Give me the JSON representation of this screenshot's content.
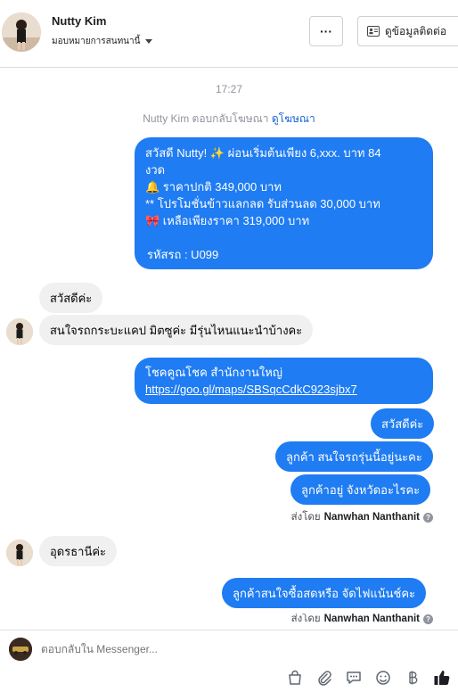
{
  "header": {
    "contact_name": "Nutty Kim",
    "assign_label": "มอบหมายการสนทนานี้",
    "more_label": "···",
    "profile_button_label": "ดูข้อมูลติดต่อ"
  },
  "conversation": {
    "timestamp": "17:27",
    "ad_note_prefix": "Nutty Kim ตอบกลับโฆษณา",
    "ad_note_link": "ดูโฆษณา",
    "promo_message": {
      "line1": "สวัสดี Nutty! ✨  ผ่อนเริ่มต้นเพียง 6,xxx. บาท 84",
      "line2": "งวด",
      "line3": "🔔 ราคาปกติ 349,000 บาท",
      "line4": "** โปรโมชั่นข้าวแลกลด รับส่วนลด 30,000 บาท",
      "line5": "🎀  เหลือเพียงราคา 319,000 บาท",
      "line6": "รหัสรถ : U099"
    },
    "customer_msg1": "สวัสดีค่ะ",
    "customer_msg2": "สนใจรถกระบะแคป มิตซูค่ะ มีรุ่นไหนแนะนำบ้างคะ",
    "showroom_msg": {
      "line1": "โชคคูณโชค สำนักงานใหญ่",
      "url": "https://goo.gl/maps/SBSqcCdkC923sjbx7"
    },
    "page_msg1": "สวัสดีค่ะ",
    "page_msg2": "ลูกค้า สนใจรถรุ่นนี้อยู่นะคะ",
    "page_msg3": "ลูกค้าอยู่ จังหวัดอะไรคะ",
    "sent_by_prefix": "ส่งโดย",
    "sent_by_name": "Nanwhan Nanthanit",
    "customer_msg3": "อุดรธานีค่ะ",
    "page_msg4": "ลูกค้าสนใจซื้อสดหรือ จัดไฟแน้นช์คะ",
    "sent_by_prefix_2": "ส่งโดย",
    "sent_by_name_2": "Nanwhan Nanthanit"
  },
  "composer": {
    "placeholder": "ตอบกลับใน Messenger..."
  },
  "colors": {
    "outgoing_bubble": "#1f7cf2",
    "incoming_bubble": "#f1f0f0",
    "link": "#1763cf",
    "like": "#1c1e21"
  },
  "icons": [
    "more-icon",
    "contact-card-icon",
    "shop-icon",
    "attachment-icon",
    "saved-reply-icon",
    "emoji-icon",
    "baht-icon",
    "like-icon"
  ]
}
